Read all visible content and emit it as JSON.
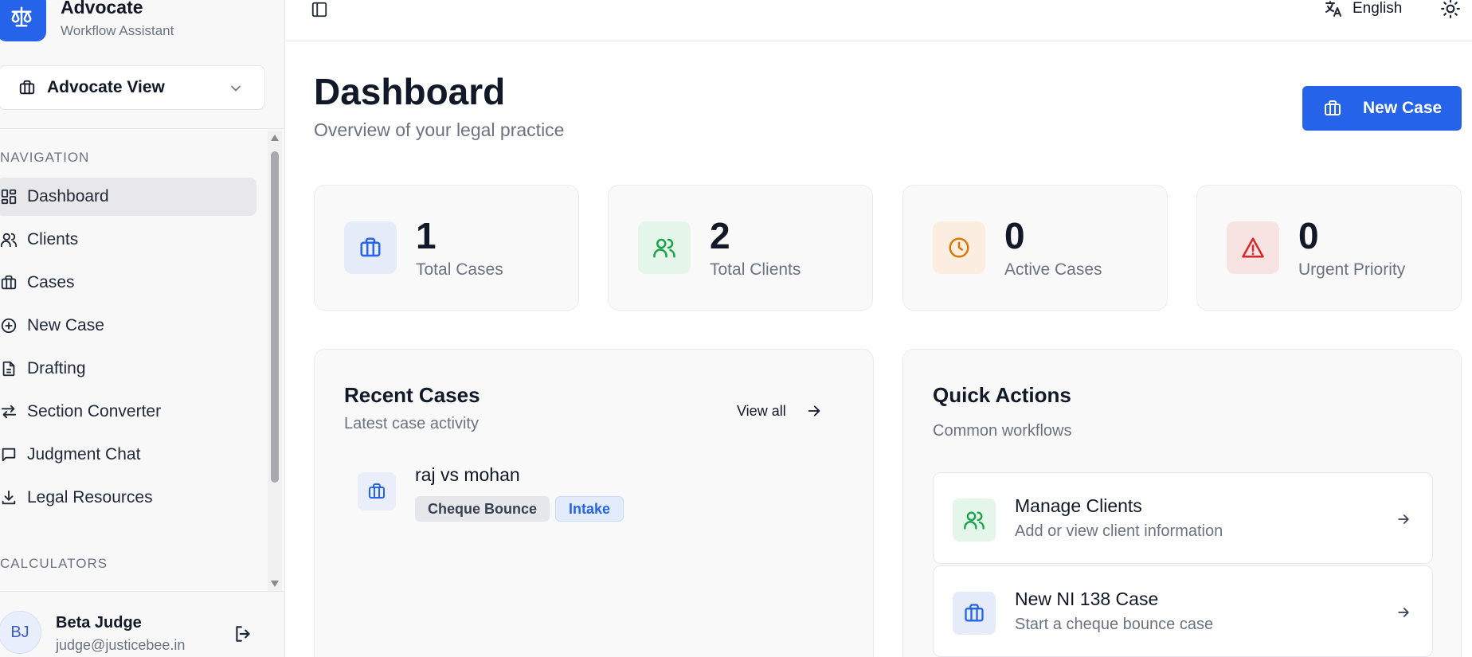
{
  "brand": {
    "name": "Advocate",
    "subtitle": "Workflow Assistant"
  },
  "view_select": {
    "label": "Advocate View"
  },
  "nav": {
    "section_label": "NAVIGATION",
    "items": [
      {
        "label": "Dashboard",
        "icon": "dashboard-icon",
        "active": true
      },
      {
        "label": "Clients",
        "icon": "users-icon"
      },
      {
        "label": "Cases",
        "icon": "briefcase-icon"
      },
      {
        "label": "New Case",
        "icon": "plus-circle-icon"
      },
      {
        "label": "Drafting",
        "icon": "document-icon"
      },
      {
        "label": "Section Converter",
        "icon": "swap-arrows-icon"
      },
      {
        "label": "Judgment Chat",
        "icon": "chat-icon"
      },
      {
        "label": "Legal Resources",
        "icon": "download-icon"
      }
    ],
    "calculators_label": "CALCULATORS"
  },
  "user": {
    "initials": "BJ",
    "name": "Beta Judge",
    "email": "judge@justicebee.in"
  },
  "topbar": {
    "language": "English"
  },
  "header": {
    "title": "Dashboard",
    "subtitle": "Overview of your legal practice",
    "new_case_label": "New Case"
  },
  "stats": [
    {
      "value": "1",
      "label": "Total Cases",
      "icon": "briefcase-icon",
      "color": "#2563eb"
    },
    {
      "value": "2",
      "label": "Total Clients",
      "icon": "users-icon",
      "color": "#16a34a"
    },
    {
      "value": "0",
      "label": "Active Cases",
      "icon": "clock-icon",
      "color": "#d97706"
    },
    {
      "value": "0",
      "label": "Urgent Priority",
      "icon": "warning-icon",
      "color": "#dc2626"
    }
  ],
  "recent": {
    "title": "Recent Cases",
    "subtitle": "Latest case activity",
    "view_all": "View all",
    "cases": [
      {
        "title": "raj vs mohan",
        "type": "Cheque Bounce",
        "status": "Intake"
      }
    ]
  },
  "quick": {
    "title": "Quick Actions",
    "subtitle": "Common workflows",
    "items": [
      {
        "title": "Manage Clients",
        "subtitle": "Add or view client information",
        "icon": "users-icon"
      },
      {
        "title": "New NI 138 Case",
        "subtitle": "Start a cheque bounce case",
        "icon": "briefcase-icon"
      }
    ]
  },
  "colors": {
    "accent": "#2563eb",
    "sidebar_bg": "#f8f8f9"
  }
}
